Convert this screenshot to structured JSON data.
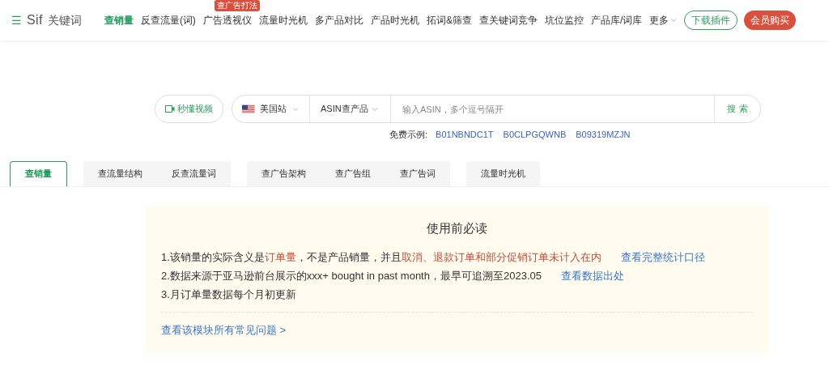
{
  "logo": {
    "menu": "☰",
    "brand": "Sif",
    "name": "关键词"
  },
  "nav": [
    {
      "label": "查销量",
      "selected": true
    },
    {
      "label": "反查流量(词)",
      "selected": false
    },
    {
      "label": "广告透视仪",
      "selected": false,
      "badge": "查广告打法"
    },
    {
      "label": "流量时光机",
      "selected": false
    },
    {
      "label": "多产品对比",
      "selected": false
    },
    {
      "label": "产品时光机",
      "selected": false
    },
    {
      "label": "拓词&筛查",
      "selected": false
    },
    {
      "label": "查关键词竞争",
      "selected": false
    },
    {
      "label": "坑位监控",
      "selected": false
    },
    {
      "label": "产品库/词库",
      "selected": false
    },
    {
      "label": "更多",
      "selected": false,
      "dropdown": true
    }
  ],
  "header_buttons": [
    {
      "label": "下载插件",
      "kind": "outline"
    },
    {
      "label": "会员购买",
      "kind": "filled"
    }
  ],
  "search": {
    "video_button": "秒懂视频",
    "site": "美国站",
    "mode": "ASIN查产品",
    "placeholder": "输入ASIN，多个逗号隔开",
    "submit": "搜 索"
  },
  "examples": {
    "label": "免费示例:",
    "items": [
      "B01NBNDC1T",
      "B0CLPGQWNB",
      "B09319MZJN"
    ]
  },
  "tab_groups": [
    [
      {
        "label": "查销量",
        "selected": true
      }
    ],
    [
      {
        "label": "查流量结构",
        "selected": false
      },
      {
        "label": "反查流量词",
        "selected": false
      }
    ],
    [
      {
        "label": "查广告架构",
        "selected": false
      },
      {
        "label": "查广告组",
        "selected": false
      },
      {
        "label": "查广告词",
        "selected": false
      }
    ],
    [
      {
        "label": "流量时光机",
        "selected": false
      }
    ]
  ],
  "notice": {
    "title": "使用前必读",
    "items": [
      {
        "parts": [
          {
            "text": "1.该销量的实际含义是",
            "kind": "plain"
          },
          {
            "text": "订单量",
            "kind": "highlight"
          },
          {
            "text": "，不是产品销量，并且",
            "kind": "plain"
          },
          {
            "text": "取消、退款订单和部分促销订单未计入在内",
            "kind": "highlight"
          }
        ],
        "link": "查看完整统计口径"
      },
      {
        "parts": [
          {
            "text": "2.数据来源于亚马逊前台展示的xxx+ bought in past month，最早可追溯至2023.05",
            "kind": "plain"
          }
        ],
        "link": "查看数据出处"
      },
      {
        "parts": [
          {
            "text": "3.月订单量数据每个月初更新",
            "kind": "plain"
          }
        ]
      }
    ],
    "faq_link": "查看该模块所有常见问题 >"
  }
}
